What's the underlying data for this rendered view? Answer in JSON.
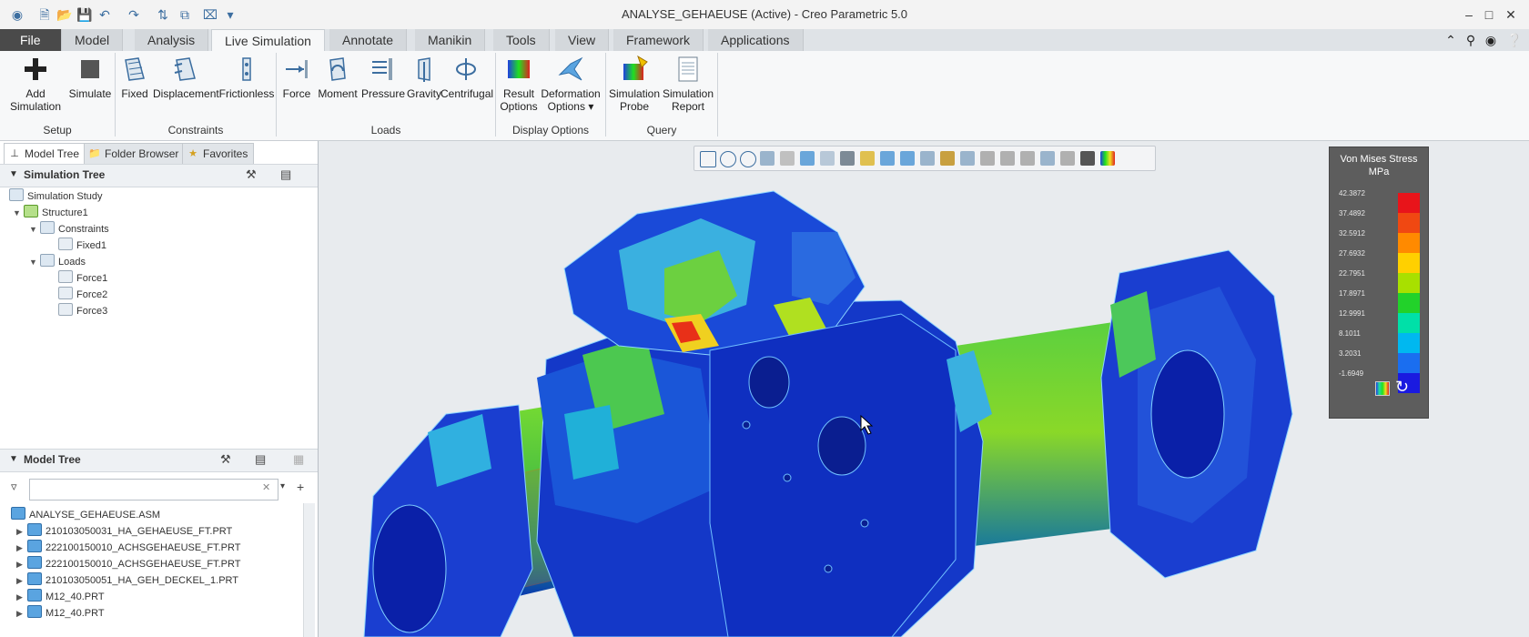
{
  "window": {
    "title": "ANALYSE_GEHAEUSE (Active) - Creo Parametric 5.0",
    "controls": [
      "minimize",
      "maximize",
      "close"
    ]
  },
  "tabs": [
    {
      "label": "File"
    },
    {
      "label": "Model"
    },
    {
      "label": "Analysis"
    },
    {
      "label": "Live Simulation"
    },
    {
      "label": "Annotate"
    },
    {
      "label": "Manikin"
    },
    {
      "label": "Tools"
    },
    {
      "label": "View"
    },
    {
      "label": "Framework"
    },
    {
      "label": "Applications"
    }
  ],
  "ribbon": {
    "setup": {
      "label": "Setup",
      "add_simulation": "Add\nSimulation",
      "simulate": "Simulate"
    },
    "constraints": {
      "label": "Constraints",
      "fixed": "Fixed",
      "displacement": "Displacement",
      "frictionless": "Frictionless"
    },
    "loads": {
      "label": "Loads",
      "force": "Force",
      "moment": "Moment",
      "pressure": "Pressure",
      "gravity": "Gravity",
      "centrifugal": "Centrifugal"
    },
    "display": {
      "label": "Display Options",
      "result_options_1": "Result",
      "result_options_2": "Options",
      "deformation_options_1": "Deformation",
      "deformation_options_2": "Options"
    },
    "query": {
      "label": "Query",
      "probe_1": "Simulation",
      "probe_2": "Probe",
      "report_1": "Simulation",
      "report_2": "Report"
    }
  },
  "left_panel": {
    "tabs": [
      "Model Tree",
      "Folder Browser",
      "Favorites"
    ],
    "simulation_tree": {
      "header": "Simulation Tree",
      "items": [
        {
          "label": "Simulation Study"
        },
        {
          "label": "Structure1"
        },
        {
          "label": "Constraints"
        },
        {
          "label": "Fixed1"
        },
        {
          "label": "Loads"
        },
        {
          "label": "Force1"
        },
        {
          "label": "Force2"
        },
        {
          "label": "Force3"
        }
      ]
    },
    "model_tree": {
      "header": "Model Tree",
      "filter_placeholder": "",
      "items": [
        {
          "label": "ANALYSE_GEHAEUSE.ASM"
        },
        {
          "label": "210103050031_HA_GEHAEUSE_FT.PRT"
        },
        {
          "label": "222100150010_ACHSGEHAEUSE_FT.PRT"
        },
        {
          "label": "222100150010_ACHSGEHAEUSE_FT.PRT"
        },
        {
          "label": "210103050051_HA_GEH_DECKEL_1.PRT"
        },
        {
          "label": "M12_40.PRT"
        },
        {
          "label": "M12_40.PRT"
        }
      ]
    }
  },
  "legend": {
    "title": "Von Mises Stress",
    "unit": "MPa",
    "values": [
      "42.3872",
      "37.4892",
      "32.5912",
      "27.6932",
      "22.7951",
      "17.8971",
      "12.9991",
      "8.1011",
      "3.2031",
      "-1.6949"
    ],
    "colors": [
      "#e8141a",
      "#f04812",
      "#ff8a00",
      "#ffd000",
      "#a8e000",
      "#22d22a",
      "#00e0a8",
      "#00b8f0",
      "#1a6ef0",
      "#1a1ae0"
    ]
  },
  "colors": {
    "accent": "#3c6ea0",
    "file_tab": "#4a4a4a"
  }
}
